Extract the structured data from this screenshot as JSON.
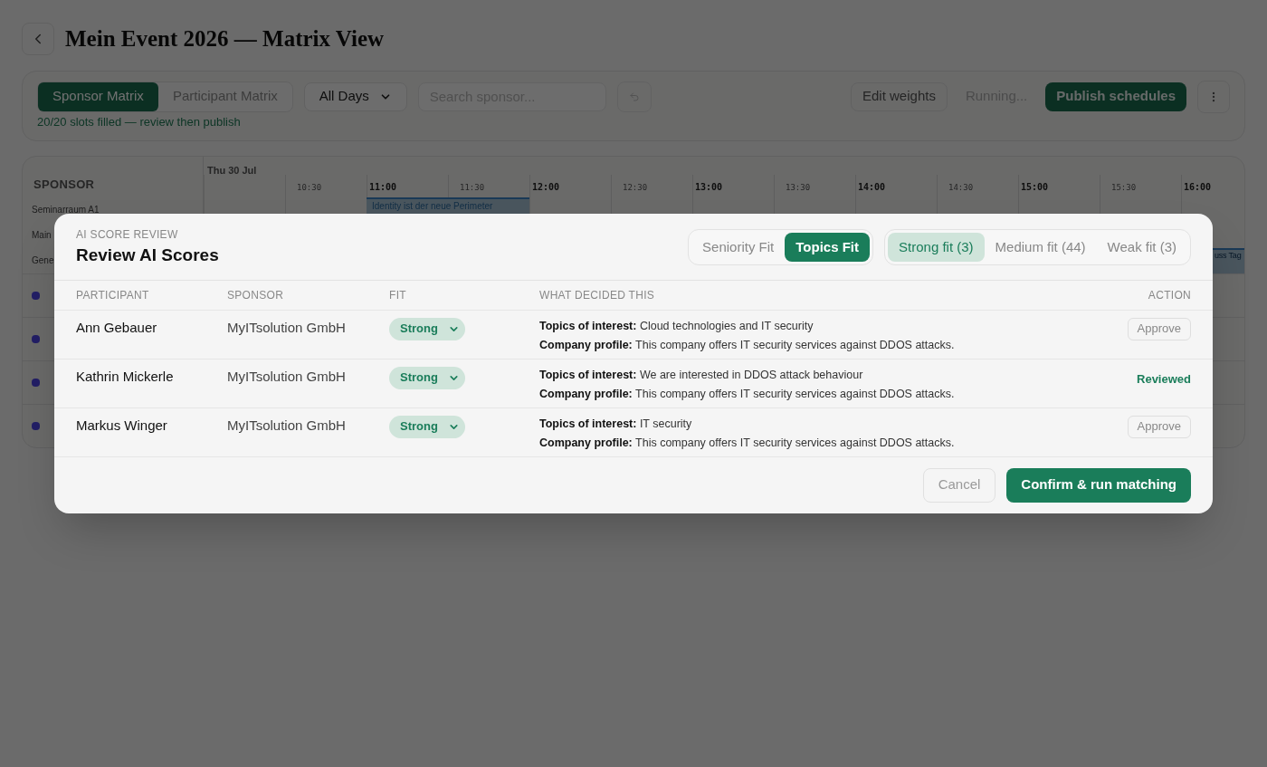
{
  "page": {
    "title": "Mein Event 2026 — Matrix View"
  },
  "toolbar": {
    "view_tabs": [
      {
        "label": "Sponsor Matrix",
        "selected": true
      },
      {
        "label": "Participant Matrix",
        "selected": false
      }
    ],
    "day_select": {
      "value": "All Days"
    },
    "search": {
      "placeholder": "Search sponsor..."
    },
    "edit_button": "Edit weights",
    "running_label": "Running...",
    "publish_button": "Publish schedules",
    "status": "20/20 slots filled — review then publish"
  },
  "schedule": {
    "date": "Thu 30 Jul",
    "column_header": "SPONSOR",
    "time_ticks": [
      {
        "kind": "blank"
      },
      {
        "label": "10:30",
        "kind": "half"
      },
      {
        "label": "11:00",
        "kind": "hour"
      },
      {
        "label": "11:30",
        "kind": "half"
      },
      {
        "label": "12:00",
        "kind": "hour"
      },
      {
        "label": "12:30",
        "kind": "half"
      },
      {
        "label": "13:00",
        "kind": "hour"
      },
      {
        "label": "13:30",
        "kind": "half"
      },
      {
        "label": "14:00",
        "kind": "hour"
      },
      {
        "label": "14:30",
        "kind": "half"
      },
      {
        "label": "15:00",
        "kind": "hour"
      },
      {
        "label": "15:30",
        "kind": "half"
      },
      {
        "label": "16:00",
        "kind": "hour"
      }
    ],
    "rows": [
      {
        "kind": "room",
        "label": "Seminarraum A1"
      },
      {
        "kind": "room",
        "label": "Main"
      },
      {
        "kind": "room",
        "label": "Gene"
      },
      {
        "kind": "logo"
      },
      {
        "kind": "logo"
      },
      {
        "kind": "logo"
      },
      {
        "kind": "logo"
      }
    ],
    "events": [
      {
        "title": "Identity ist der neue Perimeter",
        "kind": "full"
      },
      {
        "title": "uss Tag",
        "kind": "cut"
      }
    ]
  },
  "modal": {
    "eyebrow": "AI SCORE REVIEW",
    "title": "Review AI Scores",
    "score_tabs": [
      {
        "label": "Seniority Fit",
        "selected": false
      },
      {
        "label": "Topics Fit",
        "selected": true
      }
    ],
    "fit_filters": [
      {
        "label": "Strong fit (3)",
        "selected": true
      },
      {
        "label": "Medium fit (44)",
        "selected": false
      },
      {
        "label": "Weak fit (3)",
        "selected": false
      }
    ],
    "columns": [
      "PARTICIPANT",
      "SPONSOR",
      "FIT",
      "WHAT DECIDED THIS",
      "ACTION"
    ],
    "rows": [
      {
        "participant": "Ann Gebauer",
        "sponsor": "MyITsolution GmbH",
        "fit": "Strong",
        "reasons": [
          "**Topics of interest:** Cloud technologies and IT security",
          "**Company profile:** This company offers IT security services against DDOS attacks."
        ],
        "action": {
          "kind": "button",
          "label": "Approve"
        }
      },
      {
        "participant": "Kathrin Mickerle",
        "sponsor": "MyITsolution GmbH",
        "fit": "Strong",
        "reasons": [
          "**Topics of interest:** We are interested in DDOS attack behaviour",
          "**Company profile:** This company offers IT security services against DDOS attacks."
        ],
        "action": {
          "kind": "status",
          "label": "Reviewed"
        }
      },
      {
        "participant": "Markus Winger",
        "sponsor": "MyITsolution GmbH",
        "fit": "Strong",
        "reasons": [
          "**Topics of interest:** IT security",
          "**Company profile:** This company offers IT security services against DDOS attacks."
        ],
        "action": {
          "kind": "button",
          "label": "Approve"
        }
      }
    ],
    "cancel_button": "Cancel",
    "confirm_button": "Confirm & run matching"
  }
}
